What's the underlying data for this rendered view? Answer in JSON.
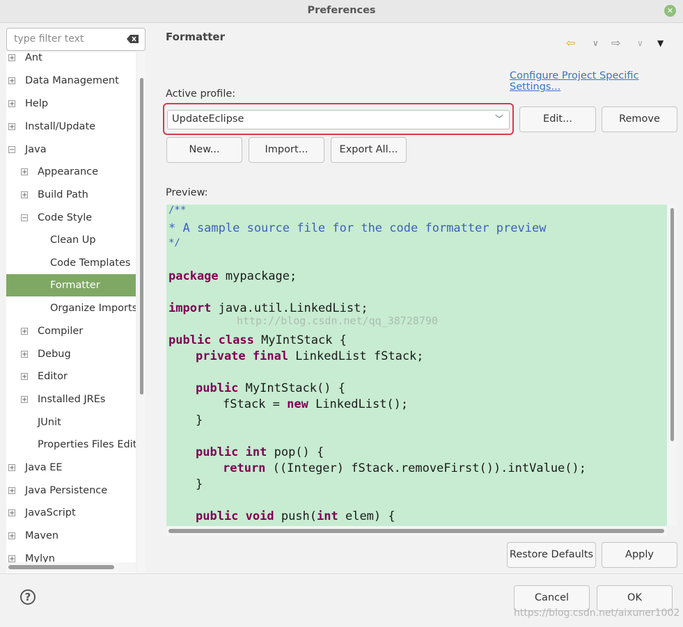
{
  "window": {
    "title": "Preferences"
  },
  "filter": {
    "placeholder": "type filter text"
  },
  "tree": {
    "ant": "Ant",
    "data_management": "Data Management",
    "help": "Help",
    "install_update": "Install/Update",
    "java": "Java",
    "appearance": "Appearance",
    "build_path": "Build Path",
    "code_style": "Code Style",
    "clean_up": "Clean Up",
    "code_templates": "Code Templates",
    "formatter": "Formatter",
    "organize_imports": "Organize Imports",
    "compiler": "Compiler",
    "debug": "Debug",
    "editor": "Editor",
    "installed_jres": "Installed JREs",
    "junit": "JUnit",
    "properties_files": "Properties Files Edito",
    "java_ee": "Java EE",
    "java_persistence": "Java Persistence",
    "javascript": "JavaScript",
    "maven": "Maven",
    "mylyn": "Mylyn"
  },
  "page": {
    "title": "Formatter",
    "configure_link": "Configure Project Specific Settings...",
    "active_profile_label": "Active profile:",
    "profile_value": "UpdateEclipse",
    "edit_button": "Edit...",
    "remove_button": "Remove",
    "new_button": "New...",
    "import_button": "Import...",
    "export_button": "Export All...",
    "preview_label": "Preview:",
    "highlight_color": "#d6394c"
  },
  "preview": {
    "l1": "/**",
    "l2": "* A sample source file for the code formatter preview",
    "l3": "*/",
    "l4_kw": "package",
    "l4": " mypackage;",
    "l5_kw": "import",
    "l5": " java.util.LinkedList;",
    "l6_kw": "public class",
    "l6": " MyIntStack {",
    "l7_kw": "private final",
    "l7": " LinkedList fStack;",
    "l8_kw": "public",
    "l8": " MyIntStack() {",
    "l9a": "fStack = ",
    "l9_kw": "new",
    "l9b": " LinkedList();",
    "l10": "}",
    "l11_kw": "public int",
    "l11": " pop() {",
    "l12_kw": "return",
    "l12": " ((Integer) fStack.removeFirst()).intValue();",
    "l13": "}",
    "l14_kw": "public void",
    "l14a": " push(",
    "l14_kw2": "int",
    "l14b": " elem) {"
  },
  "buttons": {
    "restore_defaults": "Restore Defaults",
    "apply": "Apply",
    "cancel": "Cancel",
    "ok": "OK"
  },
  "icons": {
    "back": "back-arrow-icon",
    "forward": "forward-arrow-icon",
    "menu": "view-menu-icon",
    "help": "help-icon"
  },
  "watermarks": {
    "center": "http://blog.csdn.net/qq_38728790",
    "corner": "https://blog.csdn.net/aixuner1002"
  }
}
